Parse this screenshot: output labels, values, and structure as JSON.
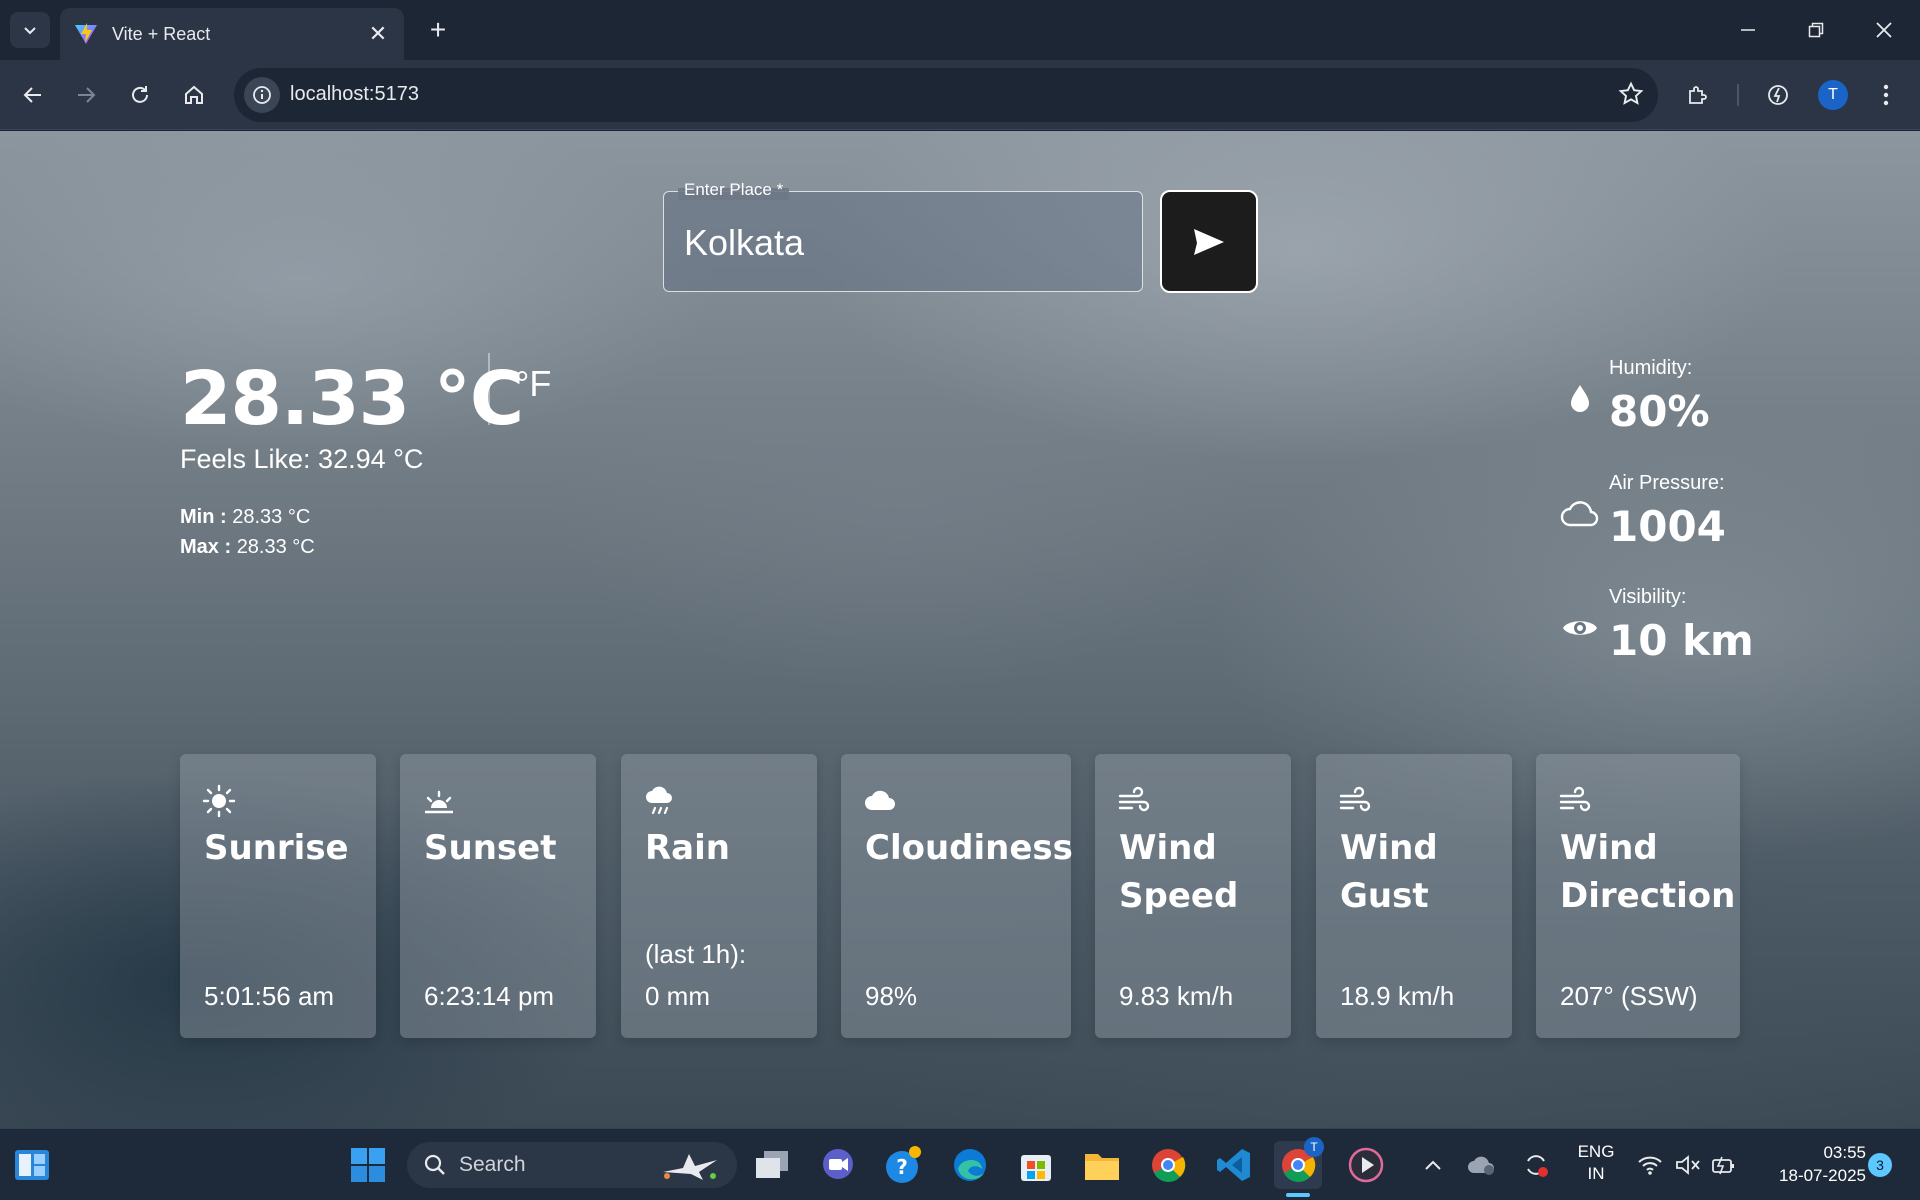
{
  "browser": {
    "tab_title": "Vite + React",
    "url": "localhost:5173",
    "profile_initial": "T"
  },
  "search": {
    "label": "Enter Place *",
    "value": "Kolkata"
  },
  "weather": {
    "temperature": "28.33 °C",
    "alt_unit": "°F",
    "feels_like": "Feels Like: 32.94 °C",
    "min_label": "Min :",
    "min_value": "28.33 °C",
    "max_label": "Max :",
    "max_value": "28.33 °C"
  },
  "stats": [
    {
      "icon": "droplet-icon",
      "label": "Humidity:",
      "value": "80%"
    },
    {
      "icon": "cloud-outline-icon",
      "label": "Air Pressure:",
      "value": "1004"
    },
    {
      "icon": "eye-icon",
      "label": "Visibility:",
      "value": "10 km"
    }
  ],
  "cards": [
    {
      "icon": "sun-icon",
      "title": "Sunrise",
      "sub": "",
      "value": "5:01:56 am"
    },
    {
      "icon": "sunset-icon",
      "title": "Sunset",
      "sub": "",
      "value": "6:23:14 pm"
    },
    {
      "icon": "rain-icon",
      "title": "Rain",
      "sub": "(last 1h):",
      "value": "0 mm"
    },
    {
      "icon": "cloud-icon",
      "title": "Cloudiness",
      "sub": "",
      "value": "98%"
    },
    {
      "icon": "wind-icon",
      "title": "Wind Speed",
      "sub": "",
      "value": "9.83 km/h"
    },
    {
      "icon": "wind-icon",
      "title": "Wind Gust",
      "sub": "",
      "value": "18.9 km/h"
    },
    {
      "icon": "wind-icon",
      "title": "Wind Direction",
      "sub": "",
      "value": "207° (SSW)"
    }
  ],
  "taskbar": {
    "search_label": "Search",
    "lang_top": "ENG",
    "lang_bottom": "IN",
    "time": "03:55",
    "date": "18-07-2025",
    "notifications": "3",
    "chrome_badge": "T"
  }
}
